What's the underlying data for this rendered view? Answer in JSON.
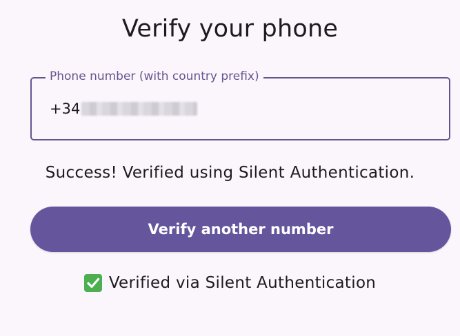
{
  "title": "Verify your phone",
  "phone_field": {
    "label": "Phone number (with country prefix)",
    "value_prefix": "+34"
  },
  "status_message": "Success! Verified using Silent Authentication.",
  "verify_button_label": "Verify another number",
  "verified_badge": {
    "icon": "check-mark-icon",
    "text": "Verified via Silent Authentication"
  },
  "colors": {
    "accent": "#65558f",
    "button": "#65559d",
    "check": "#4caf50"
  }
}
